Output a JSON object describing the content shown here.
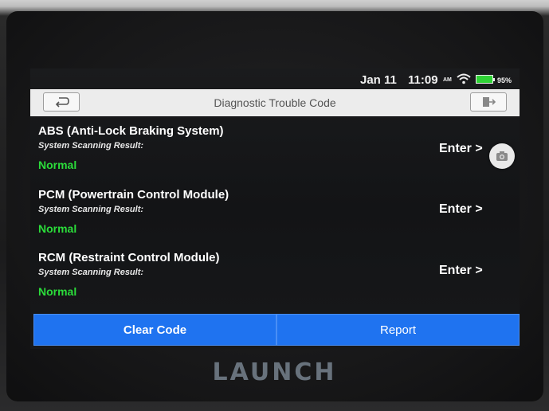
{
  "status_bar": {
    "date": "Jan 11",
    "time": "11:09",
    "ampm": "AM",
    "battery": "95%"
  },
  "header": {
    "title": "Diagnostic Trouble Code"
  },
  "modules": [
    {
      "name": "ABS (Anti-Lock Braking System)",
      "result_label": "System Scanning Result:",
      "status": "Normal",
      "enter_label": "Enter >"
    },
    {
      "name": "PCM (Powertrain Control Module)",
      "result_label": "System Scanning Result:",
      "status": "Normal",
      "enter_label": "Enter >"
    },
    {
      "name": "RCM (Restraint Control Module)",
      "result_label": "System Scanning Result:",
      "status": "Normal",
      "enter_label": "Enter >"
    }
  ],
  "actions": {
    "clear_label": "Clear Code",
    "report_label": "Report"
  },
  "brand": {
    "logo": "LAUNCH"
  },
  "colors": {
    "accent": "#1f73f0",
    "status_normal": "#2bdc3a",
    "title_bar": "#ececec"
  },
  "icons": [
    "back-arrow-icon",
    "exit-icon",
    "wifi-icon",
    "battery-icon",
    "camera-icon"
  ]
}
